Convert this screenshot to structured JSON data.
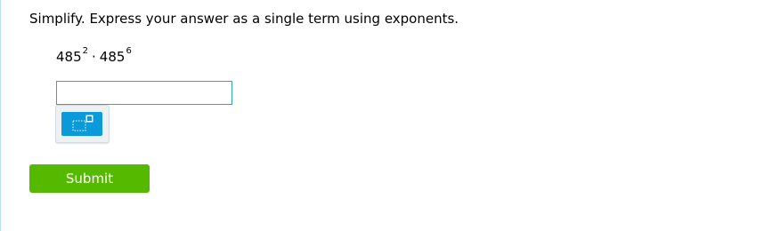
{
  "question": {
    "prompt": "Simplify. Express your answer as a single term using exponents.",
    "expression": {
      "term1_base": "485",
      "term1_exponent": "2",
      "operator": "·",
      "term2_base": "485",
      "term2_exponent": "6"
    }
  },
  "answer": {
    "value": "",
    "placeholder": ""
  },
  "tools": {
    "exponent_button_icon": "superscript-template-icon"
  },
  "actions": {
    "submit_label": "Submit"
  },
  "colors": {
    "input_border": "#2aa6c8",
    "tool_button": "#0a9ad9",
    "submit_button": "#55b900",
    "left_rule": "#b7dff4"
  }
}
